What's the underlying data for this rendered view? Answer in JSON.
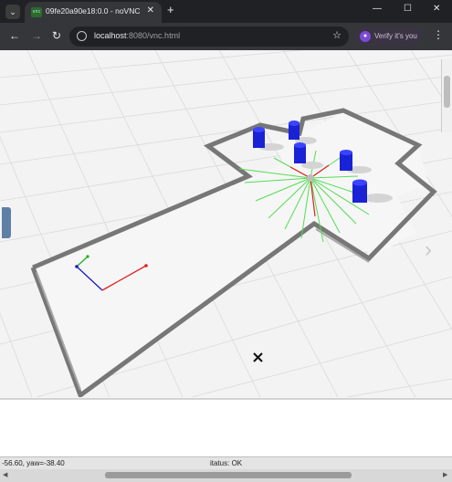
{
  "browser": {
    "tab_title": "09fe20a90e18:0.0 - noVNC",
    "favicon_text": "vnc",
    "new_tab_icon": "plus-icon",
    "url_host": "localhost",
    "url_rest": ":8080/vnc.html",
    "verify_label": "Verify it's you",
    "window_controls": [
      "minimize-icon",
      "maximize-icon",
      "close-icon"
    ]
  },
  "simulator": {
    "status_pose": "-56.60, yaw=-38.40",
    "status_text": "Status: OK",
    "status_text_visible": "Status: OK",
    "status_text_clipped": "itatus: OK",
    "colors": {
      "wall": "#6f6f6f",
      "floor": "#f2f2f2",
      "grid": "#d9d9d9",
      "obstacle": "#1a22d6",
      "laser": "#44dd44",
      "axis_x": "#e02020",
      "axis_y": "#20b020",
      "axis_z": "#1a1ac8"
    },
    "marker_icon": "cross-icon"
  }
}
